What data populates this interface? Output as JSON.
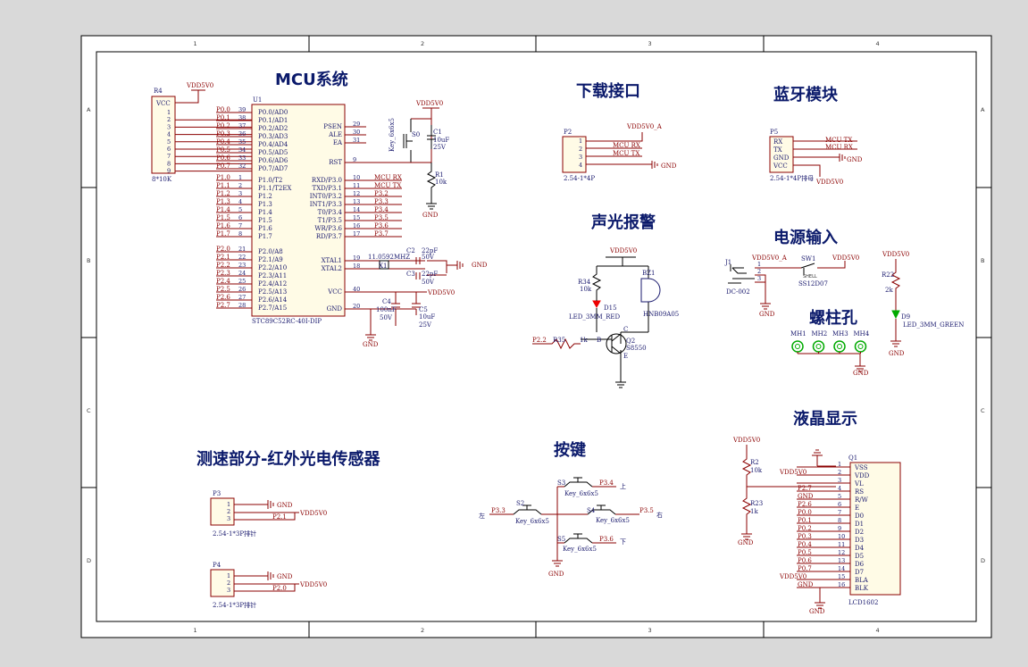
{
  "grid": {
    "cols": [
      "1",
      "2",
      "3",
      "4"
    ],
    "rows": [
      "A",
      "B",
      "C",
      "D"
    ]
  },
  "sections": {
    "mcu": "MCU系统",
    "download": "下载接口",
    "bt": "蓝牙模块",
    "buzzer": "声光报警",
    "power": "电源输入",
    "screw": "螺柱孔",
    "lcd": "液晶显示",
    "speed": "测速部分-红外光电传感器",
    "keys": "按键"
  },
  "nets": {
    "vdd": "VDD5V0",
    "vdda": "VDD5V0_A",
    "gnd": "GND",
    "mcu_rx": "MCU RX",
    "mcu_tx": "MCU TX"
  },
  "r4": {
    "ref": "R4",
    "vcc": "VCC",
    "pins": [
      "1",
      "2",
      "3",
      "4",
      "5",
      "6",
      "7",
      "8",
      "9"
    ],
    "value": "8*10K"
  },
  "u1": {
    "ref": "U1",
    "part": "STC89C52RC-40I-DIP",
    "left": [
      {
        "net": "P0.0",
        "pin": "39",
        "name": "P0.0/AD0"
      },
      {
        "net": "P0.1",
        "pin": "38",
        "name": "P0.1/AD1"
      },
      {
        "net": "P0.2",
        "pin": "37",
        "name": "P0.2/AD2"
      },
      {
        "net": "P0.3",
        "pin": "36",
        "name": "P0.3/AD3"
      },
      {
        "net": "P0.4",
        "pin": "35",
        "name": "P0.4/AD4"
      },
      {
        "net": "P0.5",
        "pin": "34",
        "name": "P0.5/AD5"
      },
      {
        "net": "P0.6",
        "pin": "33",
        "name": "P0.6/AD6"
      },
      {
        "net": "P0.7",
        "pin": "32",
        "name": "P0.7/AD7"
      },
      {
        "net": "P1.0",
        "pin": "1",
        "name": "P1.0/T2"
      },
      {
        "net": "P1.1",
        "pin": "2",
        "name": "P1.1/T2EX"
      },
      {
        "net": "P1.2",
        "pin": "3",
        "name": "P1.2"
      },
      {
        "net": "P1.3",
        "pin": "4",
        "name": "P1.3"
      },
      {
        "net": "P1.4",
        "pin": "5",
        "name": "P1.4"
      },
      {
        "net": "P1.5",
        "pin": "6",
        "name": "P1.5"
      },
      {
        "net": "P1.6",
        "pin": "7",
        "name": "P1.6"
      },
      {
        "net": "P1.7",
        "pin": "8",
        "name": "P1.7"
      },
      {
        "net": "P2.0",
        "pin": "21",
        "name": "P2.0/A8"
      },
      {
        "net": "P2.1",
        "pin": "22",
        "name": "P2.1/A9"
      },
      {
        "net": "P2.2",
        "pin": "23",
        "name": "P2.2/A10"
      },
      {
        "net": "P2.3",
        "pin": "24",
        "name": "P2.3/A11"
      },
      {
        "net": "P2.4",
        "pin": "25",
        "name": "P2.4/A12"
      },
      {
        "net": "P2.5",
        "pin": "26",
        "name": "P2.5/A13"
      },
      {
        "net": "P2.6",
        "pin": "27",
        "name": "P2.6/A14"
      },
      {
        "net": "P2.7",
        "pin": "28",
        "name": "P2.7/A15"
      }
    ],
    "right": [
      {
        "name": "PSEN",
        "pin": "29",
        "net": ""
      },
      {
        "name": "ALE",
        "pin": "30",
        "net": ""
      },
      {
        "name": "EA",
        "pin": "31",
        "net": ""
      },
      {
        "name": "RST",
        "pin": "9",
        "net": ""
      },
      {
        "name": "RXD/P3.0",
        "pin": "10",
        "net": "MCU RX"
      },
      {
        "name": "TXD/P3.1",
        "pin": "11",
        "net": "MCU TX"
      },
      {
        "name": "INT0/P3.2",
        "pin": "12",
        "net": "P3.2"
      },
      {
        "name": "INT1/P3.3",
        "pin": "13",
        "net": "P3.3"
      },
      {
        "name": "T0/P3.4",
        "pin": "14",
        "net": "P3.4"
      },
      {
        "name": "T1/P3.5",
        "pin": "15",
        "net": "P3.5"
      },
      {
        "name": "WR/P3.6",
        "pin": "16",
        "net": "P3.6"
      },
      {
        "name": "RD/P3.7",
        "pin": "17",
        "net": "P3.7"
      },
      {
        "name": "XTAL1",
        "pin": "19",
        "net": ""
      },
      {
        "name": "XTAL2",
        "pin": "18",
        "net": ""
      },
      {
        "name": "VCC",
        "pin": "40",
        "net": ""
      },
      {
        "name": "GND",
        "pin": "20",
        "net": ""
      }
    ]
  },
  "s0": {
    "ref": "S0",
    "value": "Key_6x6x5"
  },
  "c1": {
    "ref": "C1",
    "value": "10uF",
    "volt": "25V"
  },
  "r1": {
    "ref": "R1",
    "value": "10k"
  },
  "c2": {
    "ref": "C2",
    "value": "22pF",
    "volt": "50V"
  },
  "c3": {
    "ref": "C3",
    "value": "22pF",
    "volt": "50V"
  },
  "x1": {
    "ref": "X1",
    "value": "11.0592MHZ"
  },
  "c4": {
    "ref": "C4",
    "value": "100nF",
    "volt": "50V"
  },
  "c5": {
    "ref": "C5",
    "value": "10uF",
    "volt": "25V"
  },
  "p2": {
    "ref": "P2",
    "value": "2.54-1*4P",
    "pins": [
      "1",
      "2",
      "3",
      "4"
    ]
  },
  "p5": {
    "ref": "P5",
    "value": "2.54-1*4P排母",
    "pins": [
      "RX",
      "TX",
      "GND",
      "VCC"
    ]
  },
  "buzzer": {
    "r34": "R34",
    "r34v": "10k",
    "d15": "D15",
    "d15v": "LED_3MM_RED",
    "bz1": "BZ1",
    "bz1v": "HNB09A05",
    "q2": "Q2",
    "q2v": "S8550",
    "r35": "R35",
    "r35v": "1k",
    "p22": "P2.2",
    "b": "B",
    "c": "C",
    "e": "E"
  },
  "power": {
    "j1": "J1",
    "j1v": "DC-002",
    "sw1": "SW1",
    "sw1v": "SS12D07",
    "shell": "SHELL",
    "r22": "R22",
    "r22v": "2k",
    "d9": "D9",
    "d9v": "LED_3MM_GREEN",
    "pins": [
      "1",
      "2",
      "3"
    ]
  },
  "mh": [
    "MH1",
    "MH2",
    "MH3",
    "MH4"
  ],
  "p3": {
    "ref": "P3",
    "value": "2.54-1*3P排针",
    "net": "P2.1",
    "pins": [
      "1",
      "2",
      "3"
    ]
  },
  "p4": {
    "ref": "P4",
    "value": "2.54-1*3P排针",
    "net": "P2.0",
    "pins": [
      "1",
      "2",
      "3"
    ]
  },
  "keys": {
    "s2": "S2",
    "s3": "S3",
    "s4": "S4",
    "s5": "S5",
    "kv": "Key_6x6x5",
    "up": "上",
    "down": "下",
    "left": "左",
    "right": "右",
    "n33": "P3.3",
    "n34": "P3.4",
    "n35": "P3.5",
    "n36": "P3.6"
  },
  "lcd": {
    "r2": "R2",
    "r2v": "10k",
    "r23": "R23",
    "r23v": "1k",
    "ref": "Q1",
    "part": "LCD1602",
    "pins": [
      {
        "n": "1",
        "name": "VSS",
        "net": ""
      },
      {
        "n": "2",
        "name": "VDD",
        "net": "VDD5V0"
      },
      {
        "n": "3",
        "name": "VL",
        "net": ""
      },
      {
        "n": "4",
        "name": "RS",
        "net": "P2.7"
      },
      {
        "n": "5",
        "name": "R/W",
        "net": "GND"
      },
      {
        "n": "6",
        "name": "E",
        "net": "P2.6"
      },
      {
        "n": "7",
        "name": "D0",
        "net": "P0.0"
      },
      {
        "n": "8",
        "name": "D1",
        "net": "P0.1"
      },
      {
        "n": "9",
        "name": "D2",
        "net": "P0.2"
      },
      {
        "n": "10",
        "name": "D3",
        "net": "P0.3"
      },
      {
        "n": "11",
        "name": "D4",
        "net": "P0.4"
      },
      {
        "n": "12",
        "name": "D5",
        "net": "P0.5"
      },
      {
        "n": "13",
        "name": "D6",
        "net": "P0.6"
      },
      {
        "n": "14",
        "name": "D7",
        "net": "P0.7"
      },
      {
        "n": "15",
        "name": "BLA",
        "net": "VDD5V0"
      },
      {
        "n": "16",
        "name": "BLK",
        "net": "GND"
      }
    ]
  }
}
